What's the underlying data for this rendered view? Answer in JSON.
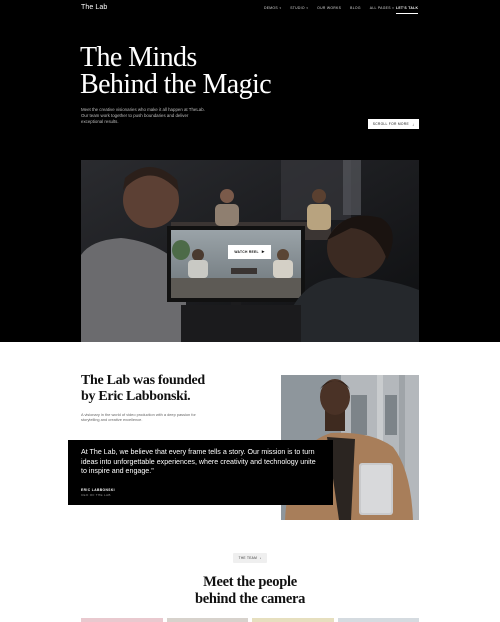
{
  "nav": {
    "logo": "The Lab",
    "items": [
      {
        "label": "DEMOS",
        "has_dropdown": true
      },
      {
        "label": "STUDIO",
        "has_dropdown": true
      },
      {
        "label": "OUR WORKS",
        "has_dropdown": false
      },
      {
        "label": "BLOG",
        "has_dropdown": false
      },
      {
        "label": "ALL PAGES",
        "has_dropdown": true
      }
    ],
    "cta_label": "LET'S TALK"
  },
  "hero": {
    "title_line1": "The Minds",
    "title_line2": "Behind the Magic",
    "description": "Meet the creative visionaries who make it all happen at TheLab. Our team work together to push boundaries and deliver exceptional results.",
    "scroll_button": "SCROLL FOR MORE",
    "watch_button": "WATCH REEL"
  },
  "founder": {
    "title_line1": "The Lab was founded",
    "title_line2": "by Eric Labbonski.",
    "description": "A visionary in the world of video production with a deep passion for storytelling and creative excellence.",
    "quote": "At The Lab, we believe that every frame tells a story. Our mission is to turn ideas into unforgettable experiences, where creativity and technology unite to inspire and engage.\"",
    "quote_name": "ERIC LABBONSKI",
    "quote_role": "CEO OF THE LAB"
  },
  "team": {
    "badge": "THE TEAM",
    "title_line1": "Meet the people",
    "title_line2": "behind the camera"
  },
  "colors": {
    "background_dark": "#000000",
    "background_light": "#ffffff",
    "text_light": "#ffffff",
    "text_dark": "#111111",
    "badge_bg": "#efefef"
  }
}
